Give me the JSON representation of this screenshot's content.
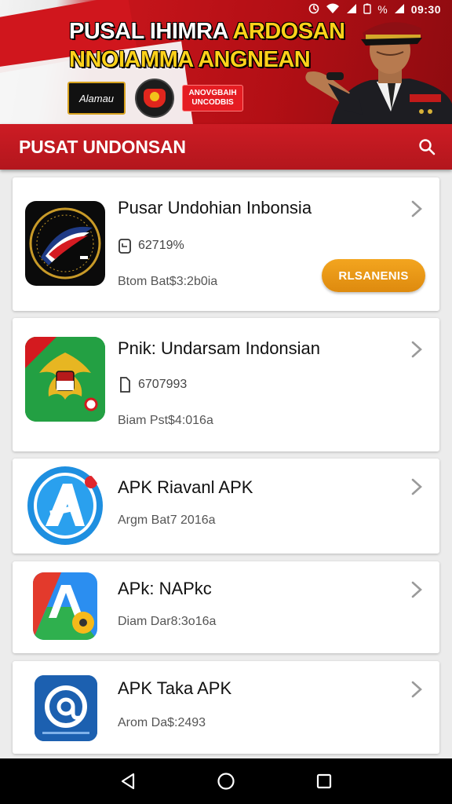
{
  "status_bar": {
    "time": "09:30",
    "battery_text": "%"
  },
  "banner": {
    "title_line1_white": "PUSAL IHIMRA ",
    "title_line1_gold": "ARDOSAN",
    "title_line2": "NNOIAMMA ANGNEAN",
    "logo_text": "Alamau",
    "badge_text": "ANOVGBAIH UNCODBIS"
  },
  "app_bar": {
    "title": "PUSAT UNDONSAN"
  },
  "apps": [
    {
      "name": "Pusar Undohian Inbonsia",
      "meta": "62719%",
      "date": "Btom Bat$3:2b0ia",
      "button": "RLSANENIS"
    },
    {
      "name": "Pnik: Undarsam Indonsian",
      "meta": "6707993",
      "date": "Biam Pst$4:016a"
    },
    {
      "name": "APK Riavanl APK",
      "date": "Argm Bat7 2016a"
    },
    {
      "name": "APk: NAPkc",
      "date": "Diam Dar8:3o16a"
    },
    {
      "name": "APK Taka APK",
      "date": "Arom Da$:2493"
    }
  ],
  "colors": {
    "primary_red": "#c8161d",
    "accent_orange": "#e9951a"
  }
}
